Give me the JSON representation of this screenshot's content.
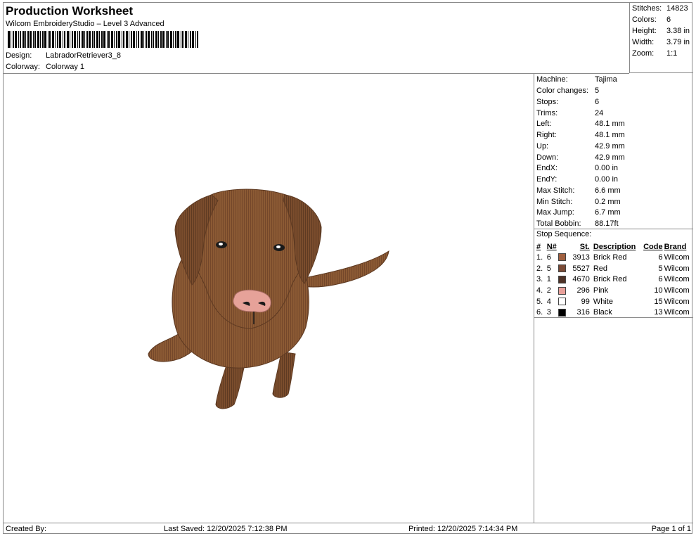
{
  "header": {
    "title": "Production Worksheet",
    "subtitle": "Wilcom EmbroideryStudio – Level 3 Advanced",
    "design_label": "Design:",
    "design_value": "LabradorRetriever3_8",
    "colorway_label": "Colorway:",
    "colorway_value": "Colorway 1"
  },
  "stats": {
    "stitches_label": "Stitches:",
    "stitches_value": "14823",
    "colors_label": "Colors:",
    "colors_value": "6",
    "height_label": "Height:",
    "height_value": "3.38 in",
    "width_label": "Width:",
    "width_value": "3.79 in",
    "zoom_label": "Zoom:",
    "zoom_value": "1:1"
  },
  "machine": {
    "machine_label": "Machine:",
    "machine_value": "Tajima",
    "color_changes_label": "Color changes:",
    "color_changes_value": "5",
    "stops_label": "Stops:",
    "stops_value": "6",
    "trims_label": "Trims:",
    "trims_value": "24",
    "left_label": "Left:",
    "left_value": "48.1 mm",
    "right_label": "Right:",
    "right_value": "48.1 mm",
    "up_label": "Up:",
    "up_value": "42.9 mm",
    "down_label": "Down:",
    "down_value": "42.9 mm",
    "endx_label": "EndX:",
    "endx_value": "0.00 in",
    "endy_label": "EndY:",
    "endy_value": "0.00 in",
    "max_stitch_label": "Max Stitch:",
    "max_stitch_value": "6.6 mm",
    "min_stitch_label": "Min Stitch:",
    "min_stitch_value": "0.2 mm",
    "max_jump_label": "Max Jump:",
    "max_jump_value": "6.7 mm",
    "bobbin_label": "Total Bobbin:",
    "bobbin_value": "88.17ft"
  },
  "stop_sequence": {
    "title": "Stop Sequence:",
    "headers": {
      "num": "#",
      "n": "N#",
      "st": "St.",
      "desc": "Description",
      "code": "Code",
      "brand": "Brand"
    },
    "rows": [
      {
        "num": "1.",
        "n": "6",
        "color": "#a0603f",
        "st": "3913",
        "desc": "Brick Red",
        "code": "6",
        "brand": "Wilcom"
      },
      {
        "num": "2.",
        "n": "5",
        "color": "#7a4a36",
        "st": "5527",
        "desc": "Red",
        "code": "5",
        "brand": "Wilcom"
      },
      {
        "num": "3.",
        "n": "1",
        "color": "#4e3227",
        "st": "4670",
        "desc": "Brick Red",
        "code": "6",
        "brand": "Wilcom"
      },
      {
        "num": "4.",
        "n": "2",
        "color": "#e8a09a",
        "st": "296",
        "desc": "Pink",
        "code": "10",
        "brand": "Wilcom"
      },
      {
        "num": "5.",
        "n": "4",
        "color": "#ffffff",
        "st": "99",
        "desc": "White",
        "code": "15",
        "brand": "Wilcom"
      },
      {
        "num": "6.",
        "n": "3",
        "color": "#000000",
        "st": "316",
        "desc": "Black",
        "code": "13",
        "brand": "Wilcom"
      }
    ]
  },
  "footer": {
    "created_by": "Created By:",
    "last_saved": "Last Saved: 12/20/2025 7:12:38 PM",
    "printed": "Printed: 12/20/2025 7:14:34 PM",
    "page": "Page 1 of 1"
  }
}
